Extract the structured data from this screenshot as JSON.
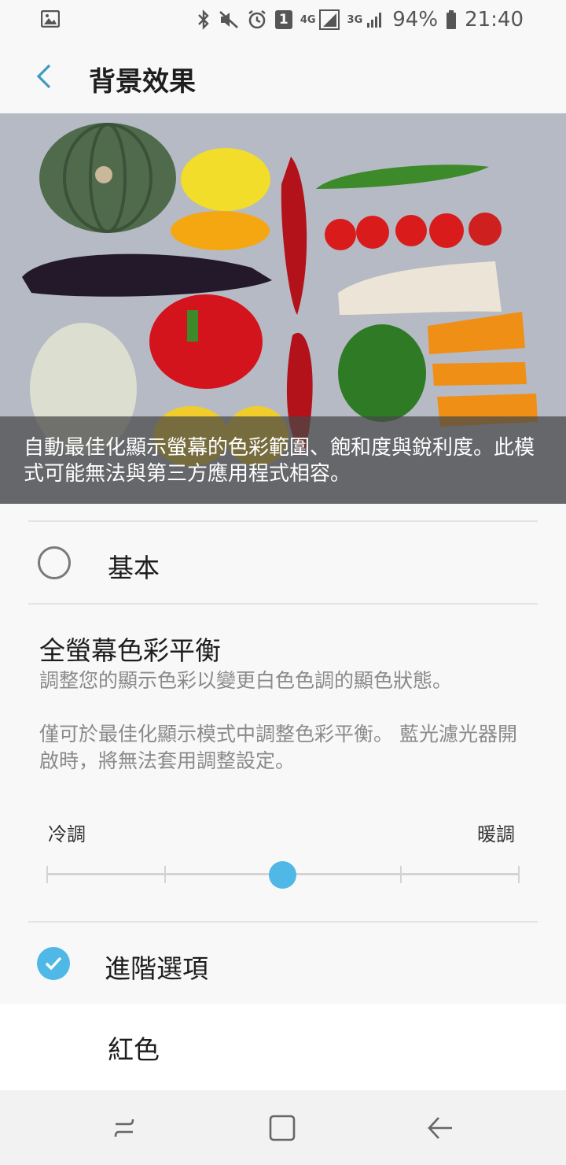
{
  "status_bar": {
    "network_4g": "4G",
    "network_3g": "3G",
    "sim_number": "1",
    "battery": "94%",
    "time": "21:40"
  },
  "header": {
    "title": "背景效果"
  },
  "hero": {
    "caption": "自動最佳化顯示螢幕的色彩範圍、飽和度與銳利度。此模式可能無法與第三方應用程式相容。"
  },
  "options": {
    "basic": {
      "label": "基本",
      "selected": false
    }
  },
  "color_balance": {
    "title": "全螢幕色彩平衡",
    "description": "調整您的顯示色彩以變更白色色調的顯色狀態。",
    "note": "僅可於最佳化顯示模式中調整色彩平衡。 藍光濾光器開啟時，將無法套用調整設定。",
    "slider": {
      "min_label": "冷調",
      "max_label": "暖調",
      "steps": 5,
      "value_index": 2
    }
  },
  "advanced": {
    "label": "進階選項",
    "checked": true
  },
  "red_item": {
    "label": "紅色"
  },
  "colors": {
    "accent": "#4fb8e6",
    "back_arrow": "#3b9bc0"
  }
}
